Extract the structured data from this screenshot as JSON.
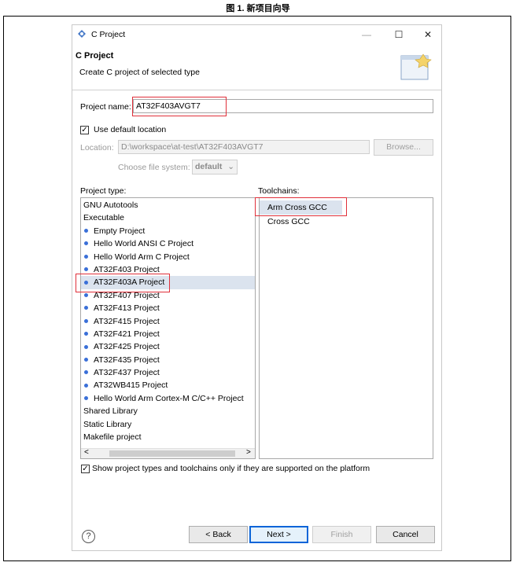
{
  "caption": "图 1. 新项目向导",
  "window": {
    "title": "C Project",
    "minimize": "—",
    "maximize": "☐",
    "close": "✕"
  },
  "header": {
    "title": "C Project",
    "description": "Create C project of selected type"
  },
  "project_name": {
    "label": "Project name:",
    "value": "AT32F403AVGT7"
  },
  "default_location": {
    "label": "Use default location",
    "checked": true
  },
  "location": {
    "label": "Location:",
    "value": "D:\\workspace\\at-test\\AT32F403AVGT7",
    "browse": "Browse..."
  },
  "file_system": {
    "label": "Choose file system:",
    "value": "default"
  },
  "project_type": {
    "label": "Project type:",
    "items": [
      {
        "label": "GNU Autotools",
        "bullet": false
      },
      {
        "label": "Executable",
        "bullet": false
      },
      {
        "label": "Empty Project",
        "bullet": true
      },
      {
        "label": "Hello World ANSI C Project",
        "bullet": true
      },
      {
        "label": "Hello World Arm C Project",
        "bullet": true
      },
      {
        "label": "AT32F403 Project",
        "bullet": true
      },
      {
        "label": "AT32F403A Project",
        "bullet": true,
        "selected": true
      },
      {
        "label": "AT32F407 Project",
        "bullet": true
      },
      {
        "label": "AT32F413 Project",
        "bullet": true
      },
      {
        "label": "AT32F415 Project",
        "bullet": true
      },
      {
        "label": "AT32F421 Project",
        "bullet": true
      },
      {
        "label": "AT32F425 Project",
        "bullet": true
      },
      {
        "label": "AT32F435 Project",
        "bullet": true
      },
      {
        "label": "AT32F437 Project",
        "bullet": true
      },
      {
        "label": "AT32WB415 Project",
        "bullet": true
      },
      {
        "label": "Hello World Arm Cortex-M C/C++ Project",
        "bullet": true
      },
      {
        "label": "Shared Library",
        "bullet": false
      },
      {
        "label": "Static Library",
        "bullet": false
      },
      {
        "label": "Makefile project",
        "bullet": false
      }
    ],
    "scroll_left": "<",
    "scroll_right": ">"
  },
  "toolchains": {
    "label": "Toolchains:",
    "items": [
      {
        "label": "Arm Cross GCC",
        "selected": true
      },
      {
        "label": "Cross GCC",
        "selected": false
      }
    ]
  },
  "show_supported": {
    "label": "Show project types and toolchains only if they are supported on the platform",
    "checked": true
  },
  "footer": {
    "help": "?",
    "back": "< Back",
    "next": "Next >",
    "finish": "Finish",
    "cancel": "Cancel"
  },
  "colors": {
    "highlight": "#e0303a",
    "selection": "#dbe3ee",
    "bullet": "#3a6fd8",
    "default_button": "#0a64d8"
  }
}
